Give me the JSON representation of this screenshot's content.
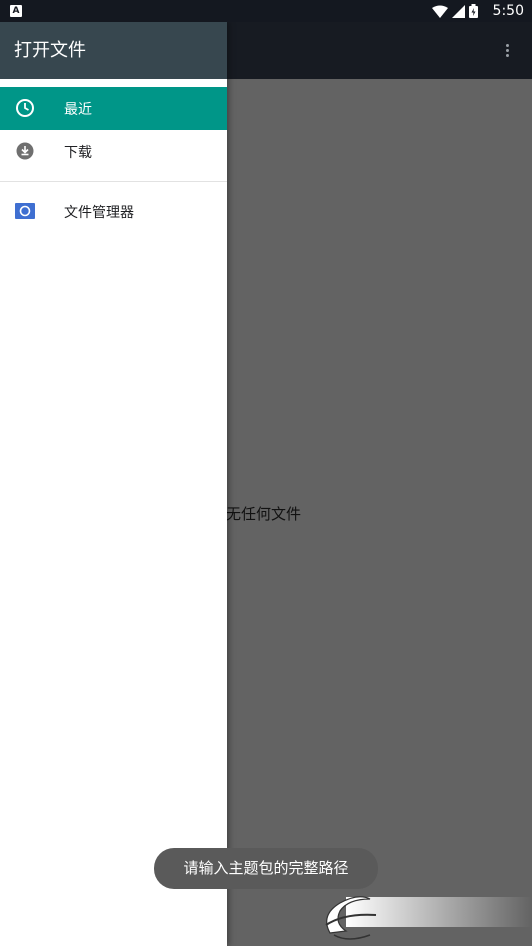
{
  "status_bar": {
    "notification_icon": "A",
    "time": "5:50",
    "icons": [
      "wifi-icon",
      "signal-icon",
      "battery-icon"
    ]
  },
  "drawer": {
    "title": "打开文件",
    "items": [
      {
        "label": "最近",
        "icon": "clock-icon",
        "active": true
      },
      {
        "label": "下载",
        "icon": "download-icon",
        "active": false
      },
      {
        "label": "文件管理器",
        "icon": "file-manager-icon",
        "active": false
      }
    ]
  },
  "main": {
    "empty_message": "无任何文件"
  },
  "toast": {
    "message": "请输入主题包的完整路径"
  },
  "colors": {
    "accent": "#009688",
    "drawer_header": "#37474f",
    "app_bar": "#171b22",
    "scrim_background": "#636363",
    "icon_blue": "#3f6fd1"
  }
}
